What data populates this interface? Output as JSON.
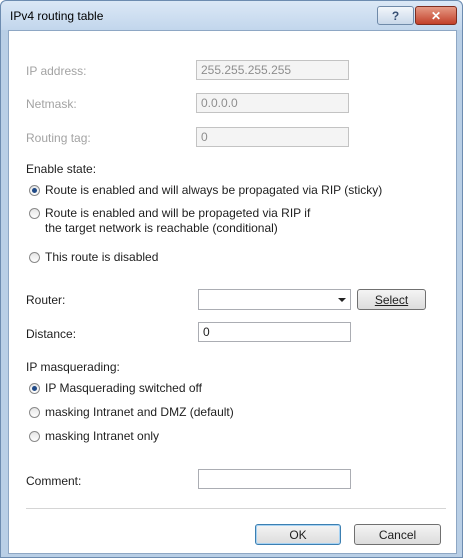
{
  "window": {
    "title": "IPv4 routing table",
    "help_label": "?",
    "close_label": "✕"
  },
  "fields": {
    "ip_address": {
      "label": "IP address:",
      "value": "255.255.255.255"
    },
    "netmask": {
      "label": "Netmask:",
      "value": "0.0.0.0"
    },
    "routing_tag": {
      "label": "Routing tag:",
      "value": "0"
    }
  },
  "enable_state": {
    "heading": "Enable state:",
    "options": [
      {
        "label": "Route is enabled and will always be propagated via RIP (sticky)",
        "checked": true
      },
      {
        "label": "Route is enabled and will be propageted via RIP if the target network is reachable (conditional)",
        "checked": false
      },
      {
        "label": "This route is disabled",
        "checked": false
      }
    ]
  },
  "router": {
    "label": "Router:",
    "value": "",
    "select_label": "Select"
  },
  "distance": {
    "label": "Distance:",
    "value": "0"
  },
  "masquerading": {
    "heading": "IP masquerading:",
    "options": [
      {
        "label": "IP Masquerading switched off",
        "checked": true
      },
      {
        "label": "masking Intranet and DMZ (default)",
        "checked": false
      },
      {
        "label": "masking Intranet only",
        "checked": false
      }
    ]
  },
  "comment": {
    "label": "Comment:",
    "value": ""
  },
  "buttons": {
    "ok": "OK",
    "cancel": "Cancel"
  }
}
